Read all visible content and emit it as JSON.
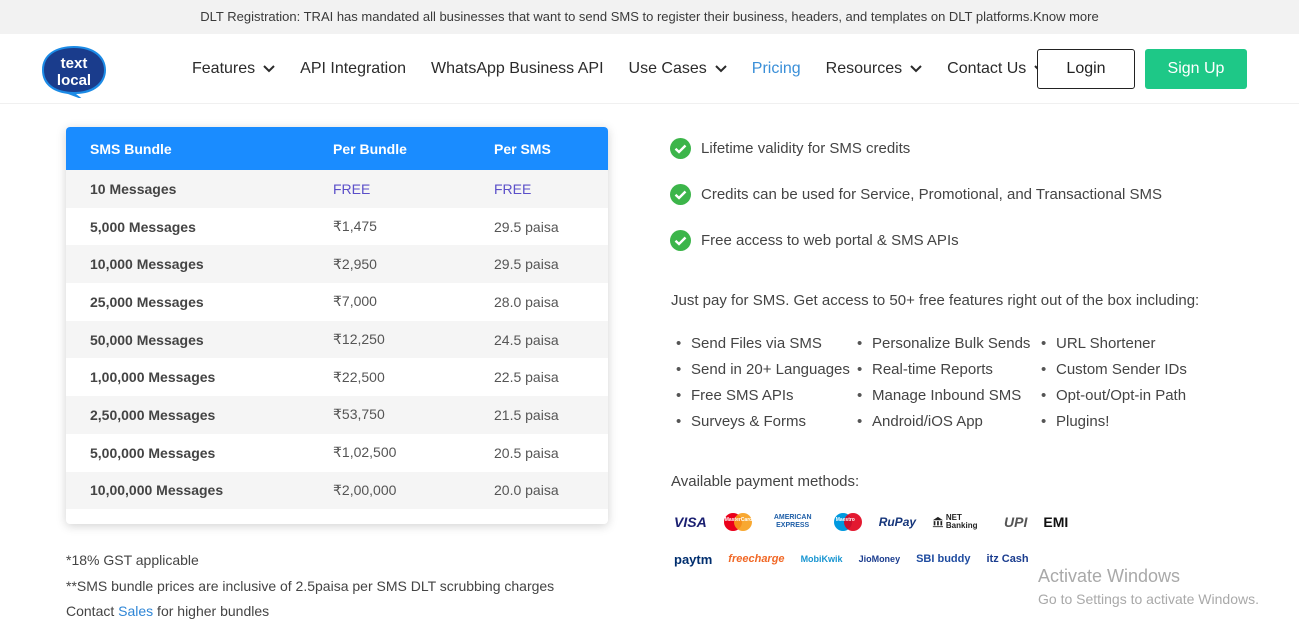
{
  "banner": {
    "text": "DLT Registration: TRAI has mandated all businesses that want to send SMS to register their business, headers, and templates on DLT platforms.",
    "link": "Know more"
  },
  "logo": {
    "line1": "text",
    "line2": "local"
  },
  "nav": [
    {
      "label": "Features",
      "has_dropdown": true
    },
    {
      "label": "API Integration",
      "has_dropdown": false
    },
    {
      "label": "WhatsApp Business API",
      "has_dropdown": false
    },
    {
      "label": "Use Cases",
      "has_dropdown": true
    },
    {
      "label": "Pricing",
      "has_dropdown": false,
      "active": true
    },
    {
      "label": "Resources",
      "has_dropdown": true
    },
    {
      "label": "Contact Us",
      "has_dropdown": true
    }
  ],
  "auth": {
    "login": "Login",
    "signup": "Sign Up"
  },
  "table": {
    "headers": [
      "SMS Bundle",
      "Per Bundle",
      "Per SMS"
    ],
    "rows": [
      [
        "10 Messages",
        "FREE",
        "FREE"
      ],
      [
        "5,000 Messages",
        "₹1,475",
        "29.5 paisa"
      ],
      [
        "10,000 Messages",
        "₹2,950",
        "29.5 paisa"
      ],
      [
        "25,000 Messages",
        "₹7,000",
        "28.0 paisa"
      ],
      [
        "50,000 Messages",
        "₹12,250",
        "24.5 paisa"
      ],
      [
        "1,00,000 Messages",
        "₹22,500",
        "22.5 paisa"
      ],
      [
        "2,50,000 Messages",
        "₹53,750",
        "21.5 paisa"
      ],
      [
        "5,00,000 Messages",
        "₹1,02,500",
        "20.5 paisa"
      ],
      [
        "10,00,000 Messages",
        "₹2,00,000",
        "20.0 paisa"
      ]
    ]
  },
  "notes": {
    "gst": "*18% GST applicable",
    "dlt": "**SMS bundle prices are inclusive of 2.5paisa per SMS DLT scrubbing charges",
    "contact_prefix": "Contact ",
    "contact_link": "Sales",
    "contact_suffix": " for higher bundles"
  },
  "benefits": [
    "Lifetime validity for SMS credits",
    "Credits can be used for Service, Promotional, and Transactional SMS",
    "Free access to web portal & SMS APIs"
  ],
  "intro": "Just pay for SMS. Get access to 50+ free features right out of the box including:",
  "features": {
    "col1": [
      "Send Files via SMS",
      "Send in 20+ Languages",
      "Free SMS APIs",
      "Surveys & Forms"
    ],
    "col2": [
      "Personalize Bulk Sends",
      "Real-time Reports",
      "Manage Inbound SMS",
      "Android/iOS App"
    ],
    "col3": [
      "URL Shortener",
      "Custom Sender IDs",
      "Opt-out/Opt-in Path",
      "Plugins!"
    ]
  },
  "payment": {
    "title": "Available payment methods:",
    "row1": [
      "VISA",
      "MasterCard",
      "AMERICAN EXPRESS",
      "Maestro",
      "RuPay",
      "NET Banking",
      "UPI",
      "EMI"
    ],
    "row2": [
      "paytm",
      "freecharge",
      "MobiKwik",
      "JioMoney",
      "SBI buddy",
      "itz Cash"
    ]
  },
  "watermark": {
    "title": "Activate Windows",
    "subtitle": "Go to Settings to activate Windows."
  },
  "colors": {
    "accent_blue": "#1a8cff",
    "signup_green": "#1ec887",
    "check_green": "#3cb54a",
    "free_purple": "#5b4fc9"
  }
}
